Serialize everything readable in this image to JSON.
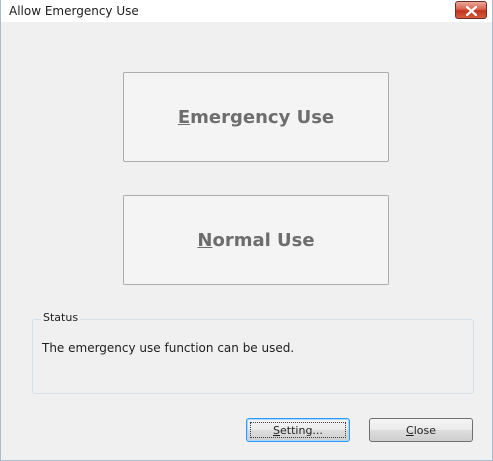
{
  "window": {
    "title": "Allow Emergency Use"
  },
  "buttons": {
    "emergency": {
      "mnemonic": "E",
      "rest": "mergency Use"
    },
    "normal": {
      "mnemonic": "N",
      "rest": "ormal Use"
    },
    "setting": {
      "mnemonic": "S",
      "rest": "etting..."
    },
    "close": {
      "mnemonic": "C",
      "rest": "lose"
    }
  },
  "status": {
    "legend": "Status",
    "message": "The emergency use function can be used."
  },
  "icons": {
    "close": "close-icon"
  },
  "colors": {
    "title_close_button": "#c2341c",
    "focus_border": "#3399ff",
    "disabled_text": "#6d6d6d"
  }
}
